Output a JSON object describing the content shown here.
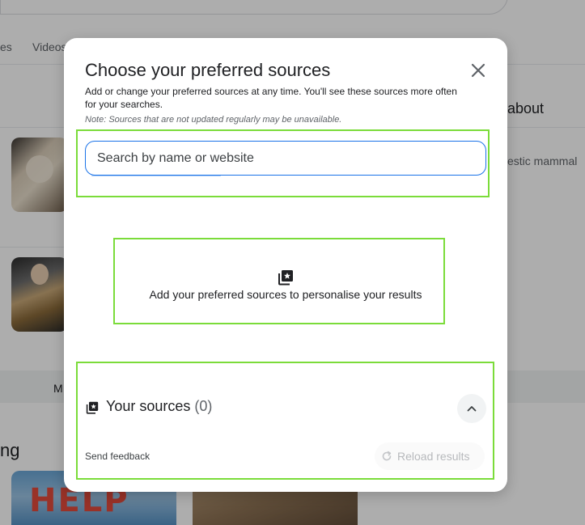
{
  "background": {
    "tabs": [
      {
        "label": "es"
      },
      {
        "label": "Videos"
      }
    ],
    "panel_heading": "about",
    "panel_subtext": "estic mammal",
    "strip_label": "M",
    "section_heading": "ng",
    "thumb_text": "HELP"
  },
  "dialog": {
    "title": "Choose your preferred sources",
    "description": "Add or change your preferred sources at any time. You'll see these sources more often for your searches.",
    "note": "Note: Sources that are not updated regularly may be unavailable.",
    "search": {
      "placeholder": "Search by name or website",
      "value": ""
    },
    "empty_state": {
      "icon": "star-library-icon",
      "text": "Add your preferred sources to personalise your results"
    },
    "your_sources": {
      "icon": "star-library-icon",
      "label": "Your sources",
      "count": "(0)"
    },
    "footer": {
      "feedback": "Send feedback",
      "reload": "Reload results"
    }
  },
  "colors": {
    "highlight": "#7bdc3a",
    "accent": "#1a73e8",
    "scrim": "rgba(0,0,0,0.32)"
  }
}
